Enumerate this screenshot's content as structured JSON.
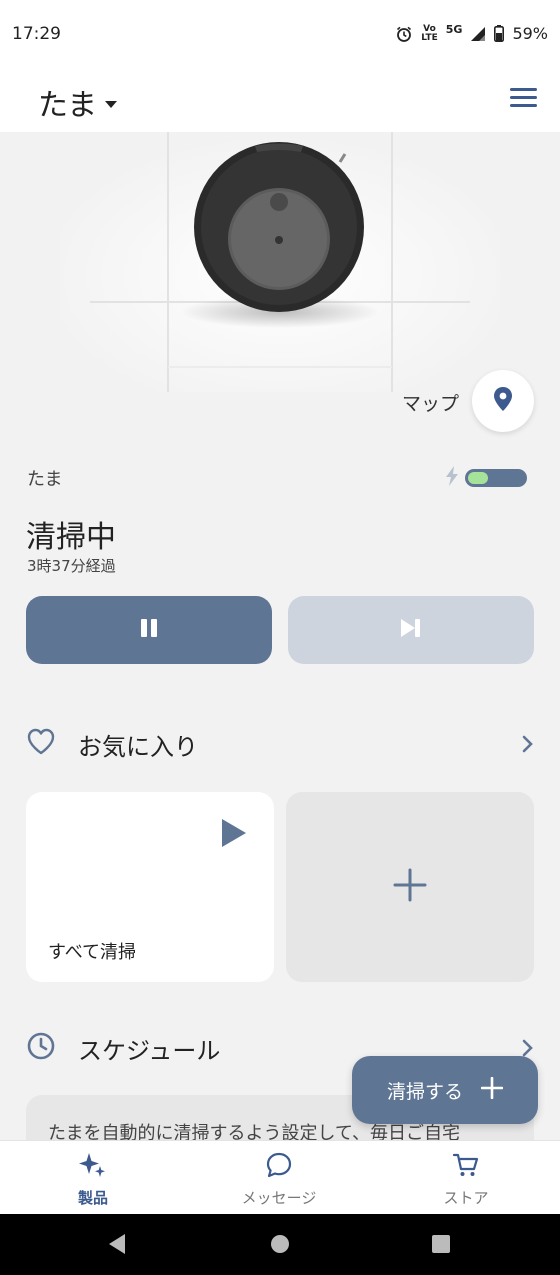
{
  "status_bar": {
    "time": "17:29",
    "volte_top": "Vo",
    "volte_bottom": "LTE",
    "network": "5G",
    "battery_text": "59%"
  },
  "header": {
    "robot_name": "たま",
    "menu_icon": "hamburger-menu-icon"
  },
  "hero": {
    "map_label": "マップ"
  },
  "robot_status": {
    "name": "たま",
    "charging": true,
    "battery_level": 0.35,
    "state": "清掃中",
    "elapsed": "3時37分経過"
  },
  "controls": {
    "pause_icon": "pause-icon",
    "skip_icon": "skip-to-end-icon"
  },
  "favorites": {
    "title": "お気に入り",
    "cards": [
      {
        "label": "すべて清掃",
        "icon": "play-icon"
      }
    ],
    "add_icon": "plus-icon"
  },
  "schedule": {
    "title": "スケジュール",
    "info": "たまを自動的に清掃するよう設定して、毎日ご自宅"
  },
  "fab": {
    "label": "清掃する"
  },
  "bottom_nav": {
    "items": [
      {
        "label": "製品",
        "active": true
      },
      {
        "label": "メッセージ",
        "active": false
      },
      {
        "label": "ストア",
        "active": false
      }
    ]
  },
  "colors": {
    "accent": "#3c5a8e",
    "slate": "#5f7594",
    "slate_light": "#cdd4de",
    "battery_green": "#a6e39a"
  }
}
